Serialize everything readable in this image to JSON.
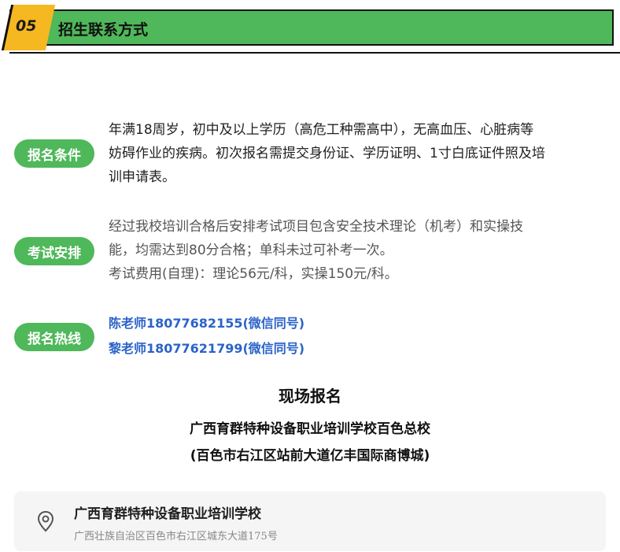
{
  "header": {
    "number": "05",
    "title": "招生联系方式"
  },
  "sections": {
    "requirements": {
      "label": "报名条件",
      "lines": [
        "年满18周岁，初中及以上学历（高危工种需高中），无高血压、心脏病等",
        "妨碍作业的疾病。初次报名需提交身份证、学历证明、1寸白底证件照及培",
        "训申请表。"
      ]
    },
    "exam": {
      "label": "考试安排",
      "lines": [
        "经过我校培训合格后安排考试项目包含安全技术理论（机考）和实操技",
        "能，均需达到80分合格；单科未过可补考一次。",
        "考试费用(自理)：理论56元/科，实操150元/科。"
      ]
    },
    "hotline": {
      "label": "报名热线",
      "lines": [
        "陈老师18077682155(微信同号)",
        "黎老师18077621799(微信同号)"
      ]
    }
  },
  "onsite": {
    "heading": "现场报名",
    "school": "广西育群特种设备职业培训学校百色总校",
    "address": "(百色市右江区站前大道亿丰国际商博城)"
  },
  "location_card": {
    "icon": "location-pin-icon",
    "title": "广西育群特种设备职业培训学校",
    "subtitle": "广西壮族自治区百色市右江区城东大道175号"
  },
  "colors": {
    "accent_green": "#4fb85a",
    "tag_yellow": "#f6b820",
    "link_blue": "#2b63c9"
  }
}
